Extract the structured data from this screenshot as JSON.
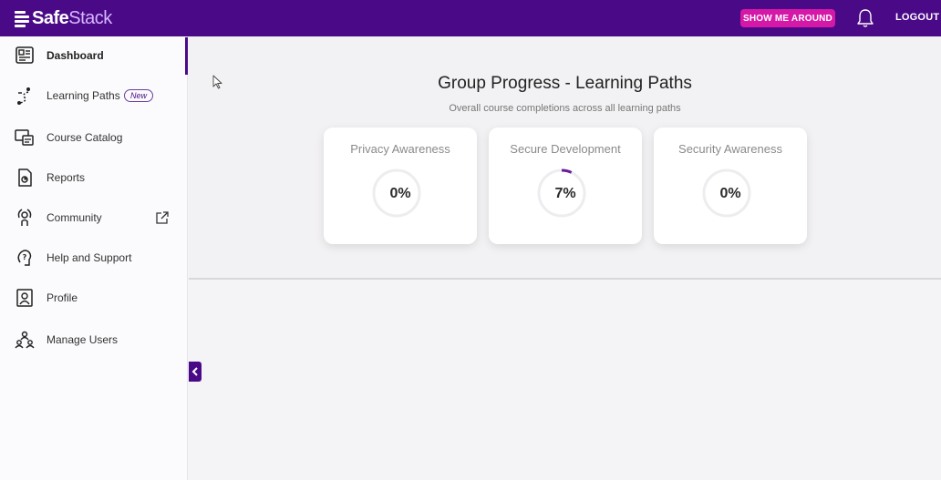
{
  "app": {
    "brand_safe": "Safe",
    "brand_stack": "Stack"
  },
  "header": {
    "tour_label": "SHOW ME AROUND",
    "logout_label": "LOGOUT"
  },
  "sidebar": {
    "items": [
      {
        "label": "Dashboard",
        "icon": "dashboard-icon",
        "active": true
      },
      {
        "label": "Learning Paths",
        "icon": "learning-path-icon",
        "badge": "New"
      },
      {
        "label": "Course Catalog",
        "icon": "course-catalog-icon"
      },
      {
        "label": "Reports",
        "icon": "reports-icon"
      },
      {
        "label": "Community",
        "icon": "community-icon",
        "external": true
      },
      {
        "label": "Help and Support",
        "icon": "help-icon"
      },
      {
        "label": "Profile",
        "icon": "profile-icon"
      },
      {
        "label": "Manage Users",
        "icon": "manage-users-icon"
      }
    ]
  },
  "main": {
    "title": "Group Progress - Learning Paths",
    "subtitle": "Overall course completions across all learning paths",
    "cards": [
      {
        "title": "Privacy Awareness",
        "percent_label": "0%",
        "progress": 0
      },
      {
        "title": "Secure Development",
        "percent_label": "7%",
        "progress": 0.07
      },
      {
        "title": "Security Awareness",
        "percent_label": "0%",
        "progress": 0
      }
    ]
  },
  "colors": {
    "brand": "#4a0a87",
    "accent": "#d518a8",
    "progress": "#6a1b9a"
  }
}
